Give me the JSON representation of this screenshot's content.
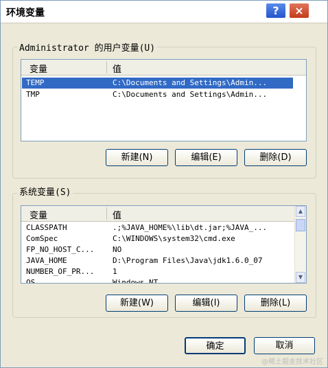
{
  "window": {
    "title": "环境变量",
    "help_glyph": "?",
    "close_glyph": "×"
  },
  "user_group": {
    "label": "Administrator 的用户变量(U)",
    "columns": [
      "变量",
      "值"
    ],
    "rows": [
      {
        "name": "TEMP",
        "value": "C:\\Documents and Settings\\Admin...",
        "selected": true
      },
      {
        "name": "TMP",
        "value": "C:\\Documents and Settings\\Admin...",
        "selected": false
      }
    ],
    "buttons": {
      "new": "新建(N)",
      "edit": "编辑(E)",
      "delete": "删除(D)"
    }
  },
  "system_group": {
    "label": "系统变量(S)",
    "columns": [
      "变量",
      "值"
    ],
    "rows": [
      {
        "name": "CLASSPATH",
        "value": ".;%JAVA_HOME%\\lib\\dt.jar;%JAVA_..."
      },
      {
        "name": "ComSpec",
        "value": "C:\\WINDOWS\\system32\\cmd.exe"
      },
      {
        "name": "FP_NO_HOST_C...",
        "value": "NO"
      },
      {
        "name": "JAVA_HOME",
        "value": "D:\\Program Files\\Java\\jdk1.6.0_07"
      },
      {
        "name": "NUMBER_OF_PR...",
        "value": "1"
      },
      {
        "name": "OS",
        "value": "Windows_NT"
      }
    ],
    "buttons": {
      "new": "新建(W)",
      "edit": "编辑(I)",
      "delete": "删除(L)"
    }
  },
  "footer": {
    "ok": "确定",
    "cancel": "取消"
  },
  "watermark": "@稀土掘金技术社区"
}
